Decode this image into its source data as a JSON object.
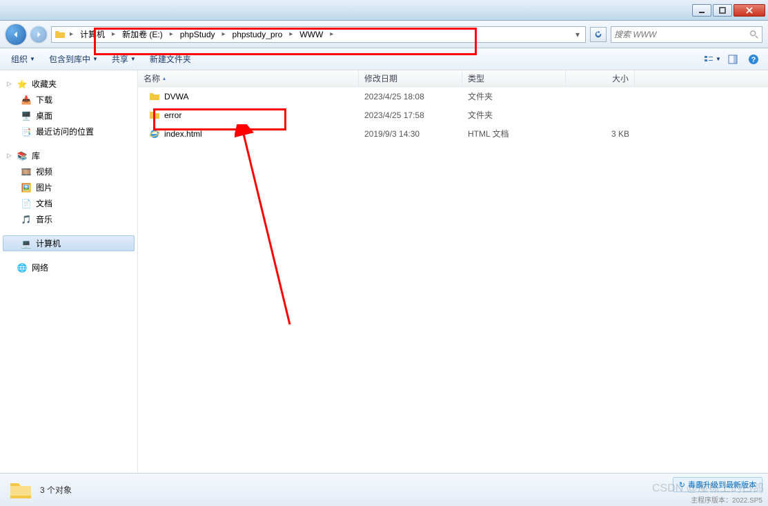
{
  "titlebar": {
    "min": "–",
    "max": "▢",
    "close": "×"
  },
  "breadcrumb": {
    "root_sep": "▸",
    "items": [
      "计算机",
      "新加卷 (E:)",
      "phpStudy",
      "phpstudy_pro",
      "WWW"
    ]
  },
  "search": {
    "placeholder": "搜索 WWW"
  },
  "toolbar": {
    "organize": "组织",
    "include": "包含到库中",
    "share": "共享",
    "newfolder": "新建文件夹"
  },
  "sidebar": {
    "favorites": {
      "label": "收藏夹",
      "items": [
        "下载",
        "桌面",
        "最近访问的位置"
      ]
    },
    "libraries": {
      "label": "库",
      "items": [
        "视频",
        "图片",
        "文档",
        "音乐"
      ]
    },
    "computer": {
      "label": "计算机"
    },
    "network": {
      "label": "网络"
    }
  },
  "columns": {
    "name": "名称",
    "date": "修改日期",
    "type": "类型",
    "size": "大小"
  },
  "rows": [
    {
      "name": "DVWA",
      "date": "2023/4/25 18:08",
      "type": "文件夹",
      "size": "",
      "icon": "folder"
    },
    {
      "name": "error",
      "date": "2023/4/25 17:58",
      "type": "文件夹",
      "size": "",
      "icon": "folder"
    },
    {
      "name": "index.html",
      "date": "2019/9/3 14:30",
      "type": "HTML 文档",
      "size": "3 KB",
      "icon": "ie"
    }
  ],
  "statusbar": {
    "count": "3 个对象"
  },
  "upgrade": "毒霸升级到最新版本",
  "version": "主程序版本：2022.SP5",
  "watermark": "CSDN @屋檐上的白鸽"
}
